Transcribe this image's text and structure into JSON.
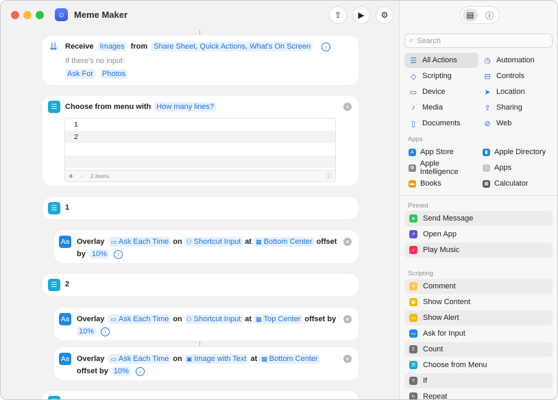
{
  "window": {
    "title": "Meme Maker"
  },
  "toolbar": {
    "share_icon": "share-icon",
    "run_icon": "play-icon",
    "settings_icon": "settings-icon"
  },
  "workflow": {
    "receive": {
      "verb": "Receive",
      "input_type": "Images",
      "from_label": "from",
      "sources": "Share Sheet, Quick Actions, What's On Screen",
      "no_input_label": "If there's no input:",
      "no_input_action": "Ask For",
      "no_input_value": "Photos"
    },
    "choose_menu": {
      "label": "Choose from menu with",
      "prompt": "How many lines?",
      "items": [
        "1",
        "2"
      ],
      "count_label": "2 items"
    },
    "branch1": {
      "label": "1",
      "overlay": {
        "verb": "Overlay",
        "text": "Ask Each Time",
        "on": "on",
        "target": "Shortcut Input",
        "at": "at",
        "position": "Bottom Center",
        "offset_label": "offset",
        "by": "by",
        "offset_value": "10%"
      }
    },
    "branch2": {
      "label": "2",
      "overlay_top": {
        "verb": "Overlay",
        "text": "Ask Each Time",
        "on": "on",
        "target": "Shortcut Input",
        "at": "at",
        "position": "Top Center",
        "offset_label": "offset by",
        "offset_value": "10%"
      },
      "overlay_bottom": {
        "verb": "Overlay",
        "text": "Ask Each Time",
        "on": "on",
        "target": "Image with Text",
        "at": "at",
        "position": "Bottom Center",
        "offset_label": "offset by",
        "offset_value": "10%"
      }
    }
  },
  "sidebar": {
    "search_placeholder": "Search",
    "categories": [
      {
        "label": "All Actions",
        "icon": "list-icon"
      },
      {
        "label": "Automation",
        "icon": "automation-icon"
      },
      {
        "label": "Scripting",
        "icon": "scripting-icon"
      },
      {
        "label": "Controls",
        "icon": "controls-icon"
      },
      {
        "label": "Device",
        "icon": "device-icon"
      },
      {
        "label": "Location",
        "icon": "location-icon"
      },
      {
        "label": "Media",
        "icon": "music-note-icon"
      },
      {
        "label": "Sharing",
        "icon": "share-icon"
      },
      {
        "label": "Documents",
        "icon": "document-icon"
      },
      {
        "label": "Web",
        "icon": "compass-icon"
      }
    ],
    "apps_header": "Apps",
    "apps": [
      {
        "label": "App Store",
        "color": "#1e88e5"
      },
      {
        "label": "Apple Directory",
        "color": "#1e88e5"
      },
      {
        "label": "Apple Intelligence",
        "color": "#888888"
      },
      {
        "label": "Apps",
        "color": "#9a9a9a"
      },
      {
        "label": "Books",
        "color": "#f39c12"
      },
      {
        "label": "Calculator",
        "color": "#555555"
      }
    ],
    "pinned_header": "Pinned",
    "pinned": [
      {
        "label": "Send Message",
        "color": "#34c759"
      },
      {
        "label": "Open App",
        "color": "#5856d6"
      },
      {
        "label": "Play Music",
        "color": "#ff2d55"
      }
    ],
    "scripting_header": "Scripting",
    "scripting": [
      {
        "label": "Comment",
        "color": "#f7c948"
      },
      {
        "label": "Show Content",
        "color": "#f5b700"
      },
      {
        "label": "Show Alert",
        "color": "#f5b700"
      },
      {
        "label": "Ask for Input",
        "color": "#1e88e5"
      },
      {
        "label": "Count",
        "color": "#6e6e73"
      },
      {
        "label": "Choose from Menu",
        "color": "#17a9d6"
      },
      {
        "label": "If",
        "color": "#6e6e73"
      },
      {
        "label": "Repeat",
        "color": "#6e6e73"
      }
    ]
  }
}
